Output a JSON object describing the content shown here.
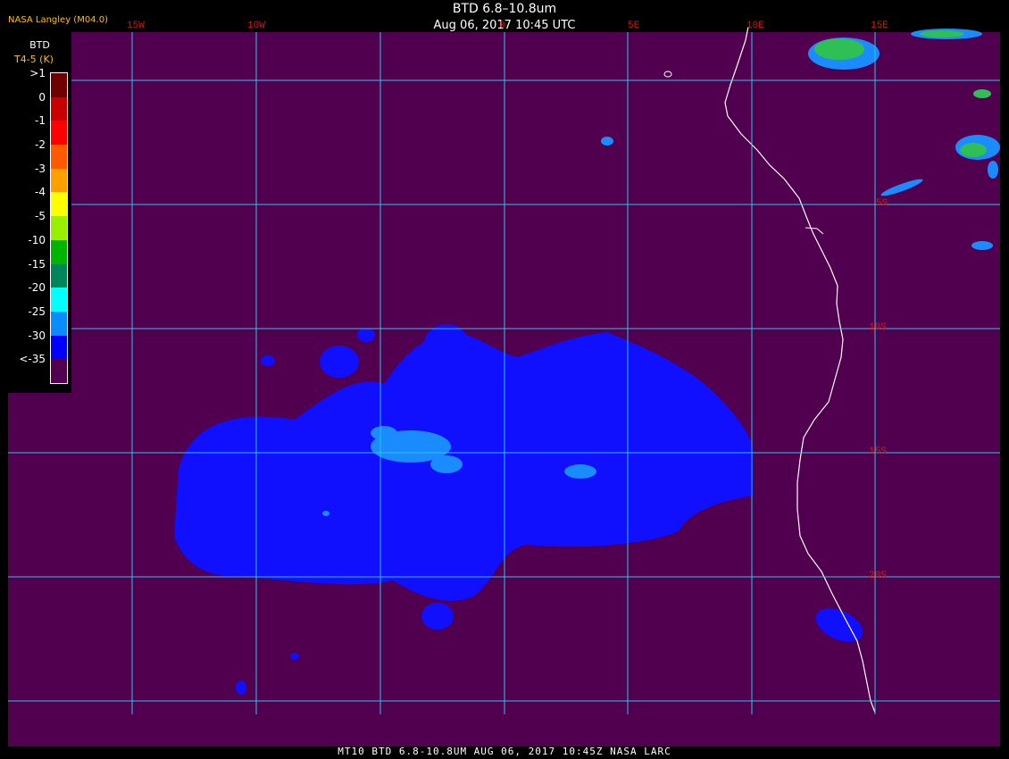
{
  "header": {
    "title": "BTD 6.8–10.8um",
    "subtitle": "Aug 06, 2017 10:45 UTC",
    "producer": "NASA Langley (M04.0)"
  },
  "footer": {
    "text": "MT10  BTD 6.8-10.8UM  AUG 06, 2017 10:45Z  NASA LARC"
  },
  "map": {
    "longitude_labels": [
      "15W",
      "10W",
      "0",
      "5E",
      "10E",
      "15E"
    ],
    "latitude_labels": [
      "5S",
      "10S",
      "15S",
      "20S"
    ],
    "colors": {
      "background": "#510050",
      "grid": "#29c4e8",
      "coastline": "#ffffff",
      "labels": "#d01818",
      "cloud_blue": "#1010ff",
      "cloud_light": "#1a8cff",
      "cloud_green": "#2fbf55"
    }
  },
  "legend": {
    "title": "BTD",
    "unit": "T4-5 (K)",
    "labels": [
      ">1",
      "0",
      "-1",
      "-2",
      "-3",
      "-4",
      "-5",
      "-10",
      "-15",
      "-20",
      "-25",
      "-30",
      "<-35"
    ],
    "colors": [
      "#6e0000",
      "#c80000",
      "#ff0000",
      "#ff5a00",
      "#ffa000",
      "#ffff00",
      "#98f000",
      "#00b400",
      "#00845a",
      "#00ffff",
      "#0a8cff",
      "#0000ff",
      "#510050"
    ]
  }
}
